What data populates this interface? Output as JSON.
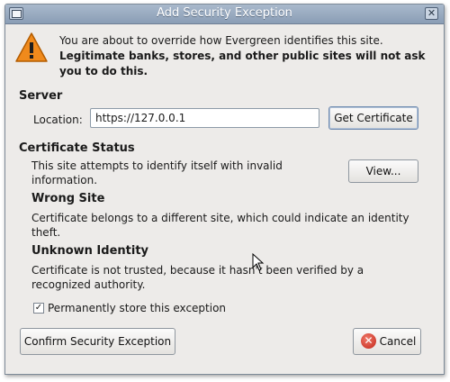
{
  "window": {
    "title": "Add Security Exception",
    "close_glyph": "✕"
  },
  "intro": {
    "line1": "You are about to override how Evergreen identifies this site.",
    "warning": "Legitimate banks, stores, and other public sites will not ask you to do this."
  },
  "server": {
    "heading": "Server",
    "location_label": "Location:",
    "location_value": "https://127.0.0.1",
    "get_certificate_label": "Get Certificate"
  },
  "certificate_status": {
    "heading": "Certificate Status",
    "description": "This site attempts to identify itself with invalid information.",
    "view_label": "View...",
    "wrong_site_heading": "Wrong Site",
    "wrong_site_text": "Certificate belongs to a different site, which could indicate an identity theft.",
    "unknown_identity_heading": "Unknown Identity",
    "unknown_identity_text": "Certificate is not trusted, because it hasn't been verified by a recognized authority."
  },
  "permanent": {
    "label": "Permanently store this exception",
    "checked": true,
    "check_glyph": "✓"
  },
  "actions": {
    "confirm_label": "Confirm Security Exception",
    "cancel_label": "Cancel",
    "cancel_icon_glyph": "✕"
  },
  "icons": {
    "warning": "warning-icon",
    "cancel": "cancel-icon",
    "mouse": "mouse-pointer-icon"
  },
  "colors": {
    "titlebar": "#8a9db5",
    "warning_fill": "#f08a1c",
    "cancel_red": "#c3261a"
  }
}
